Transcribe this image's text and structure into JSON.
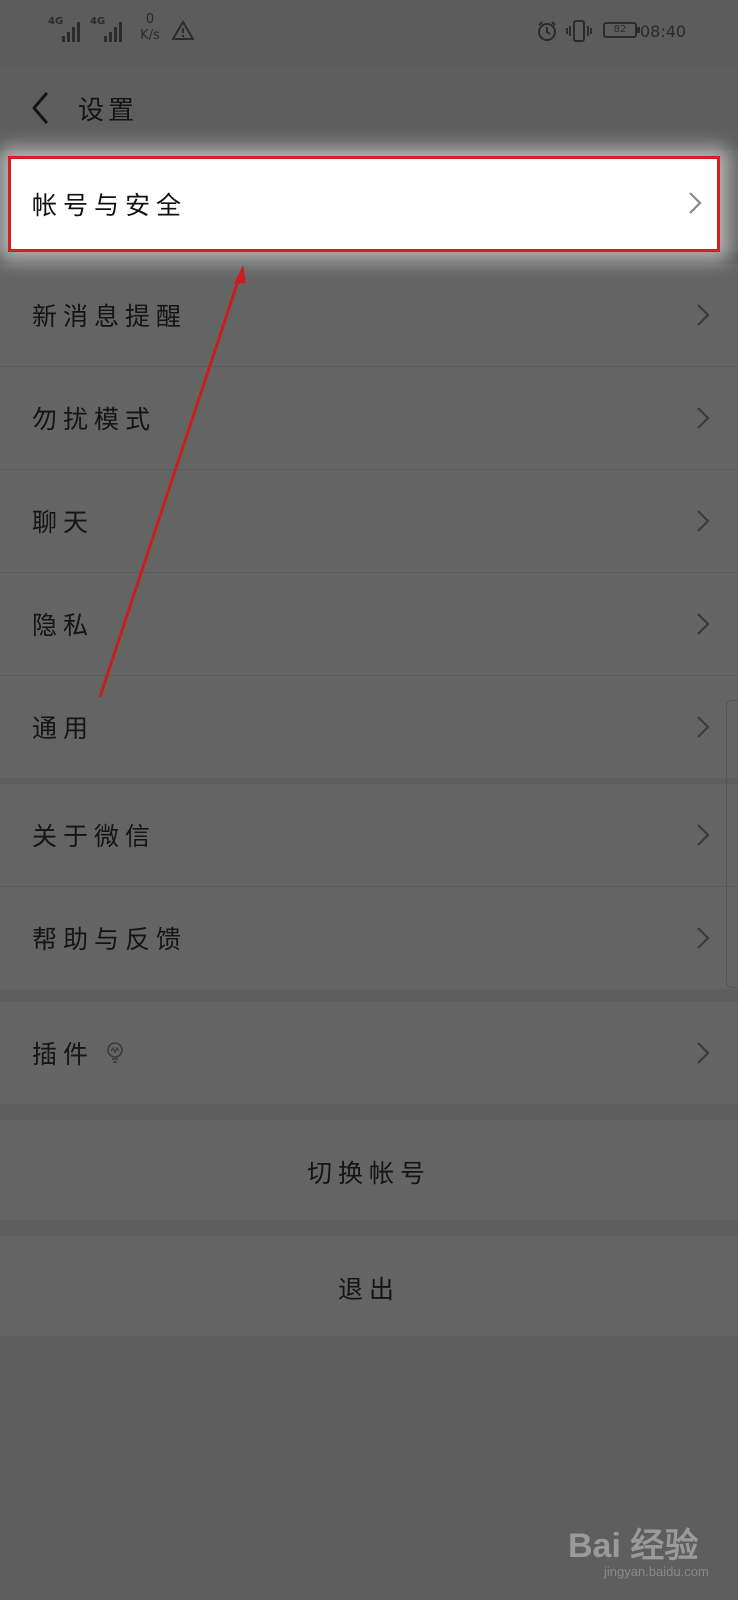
{
  "status_bar": {
    "signal1": "4G",
    "signal2": "4G",
    "net_speed_value": "0",
    "net_speed_unit": "K/s",
    "battery": "82",
    "time": "08:40"
  },
  "header": {
    "title": "设置"
  },
  "highlighted_item": {
    "label": "帐号与安全"
  },
  "groups": [
    {
      "items": [
        {
          "label": "新消息提醒"
        },
        {
          "label": "勿扰模式"
        },
        {
          "label": "聊天"
        },
        {
          "label": "隐私"
        },
        {
          "label": "通用"
        }
      ]
    },
    {
      "items": [
        {
          "label": "关于微信"
        },
        {
          "label": "帮助与反馈"
        }
      ]
    },
    {
      "items": [
        {
          "label": "插件"
        }
      ]
    }
  ],
  "buttons": {
    "switch_account": "切换帐号",
    "logout": "退出"
  },
  "watermark": {
    "brand": "Bai 经验",
    "url": "jingyan.baidu.com"
  },
  "colors": {
    "overlay_gray": "#5e5e5e",
    "highlight_border": "#d42020",
    "annotation_arrow": "#c81e1e"
  }
}
